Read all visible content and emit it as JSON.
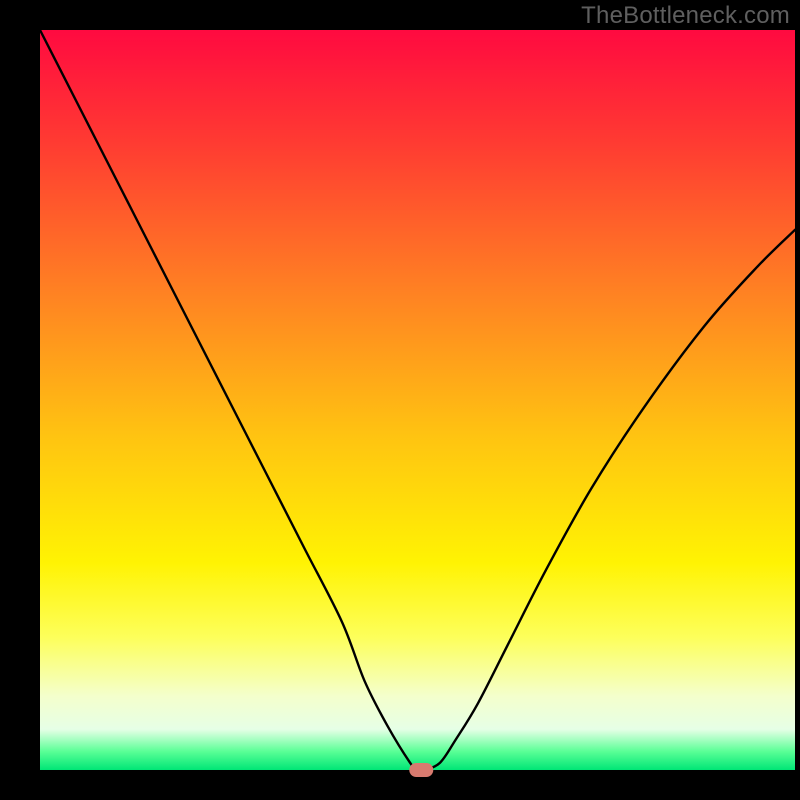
{
  "watermark": "TheBottleneck.com",
  "colors": {
    "black": "#000000",
    "curve": "#000000",
    "marker_fill": "#d87a6f",
    "gradient_stops": [
      {
        "offset": 0.0,
        "color": "#ff0a40"
      },
      {
        "offset": 0.15,
        "color": "#ff3a32"
      },
      {
        "offset": 0.35,
        "color": "#ff8023"
      },
      {
        "offset": 0.55,
        "color": "#ffc411"
      },
      {
        "offset": 0.72,
        "color": "#fff303"
      },
      {
        "offset": 0.82,
        "color": "#fdff5a"
      },
      {
        "offset": 0.9,
        "color": "#f4ffcc"
      },
      {
        "offset": 0.945,
        "color": "#e6ffe6"
      },
      {
        "offset": 0.975,
        "color": "#5aff96"
      },
      {
        "offset": 1.0,
        "color": "#00e676"
      }
    ]
  },
  "chart_data": {
    "type": "line",
    "title": "",
    "xlabel": "",
    "ylabel": "",
    "xlim": [
      0,
      100
    ],
    "ylim": [
      0,
      100
    ],
    "x": [
      0,
      5,
      10,
      15,
      20,
      25,
      30,
      35,
      40,
      43,
      46,
      49,
      50,
      51,
      53,
      55,
      58,
      62,
      67,
      73,
      80,
      88,
      95,
      100
    ],
    "values": [
      100,
      90,
      80,
      70,
      60,
      50,
      40,
      30,
      20,
      12,
      6,
      1,
      0,
      0,
      1,
      4,
      9,
      17,
      27,
      38,
      49,
      60,
      68,
      73
    ],
    "marker": {
      "x": 50.5,
      "y": 0
    }
  }
}
